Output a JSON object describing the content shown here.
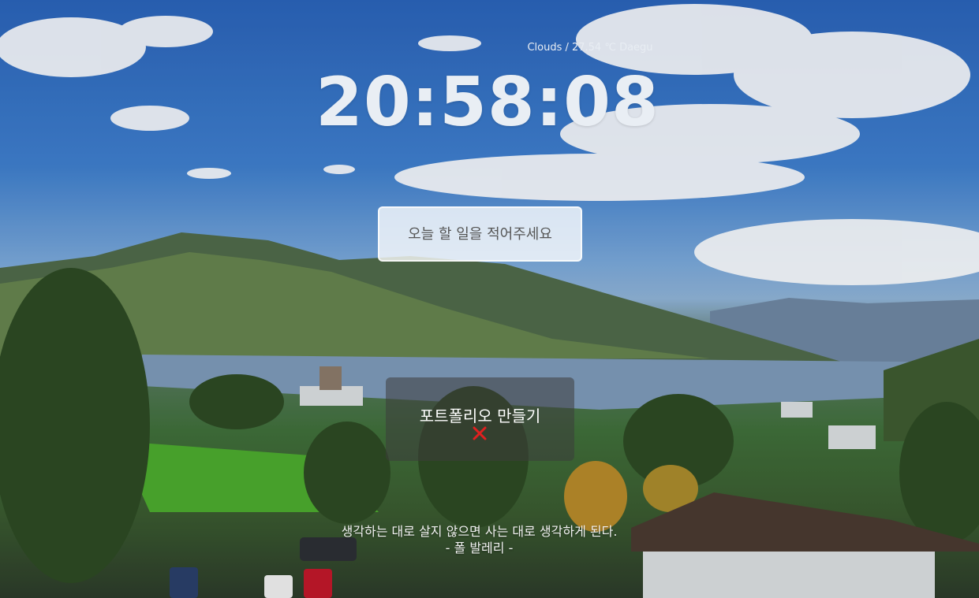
{
  "weather": {
    "text": "Clouds / 27.54 ℃ Daegu"
  },
  "clock": {
    "time": "20:58:08"
  },
  "todo_input": {
    "placeholder": "오늘 할 일을 적어주세요"
  },
  "todo_list": {
    "items": [
      {
        "label": "포트폴리오 만들기",
        "delete_icon": "close-icon"
      }
    ]
  },
  "quote": {
    "text": "생각하는 대로 살지 않으면 사는 대로 생각하게 된다.",
    "author": "- 폴 발레리 -"
  },
  "colors": {
    "delete": "#e02020"
  }
}
